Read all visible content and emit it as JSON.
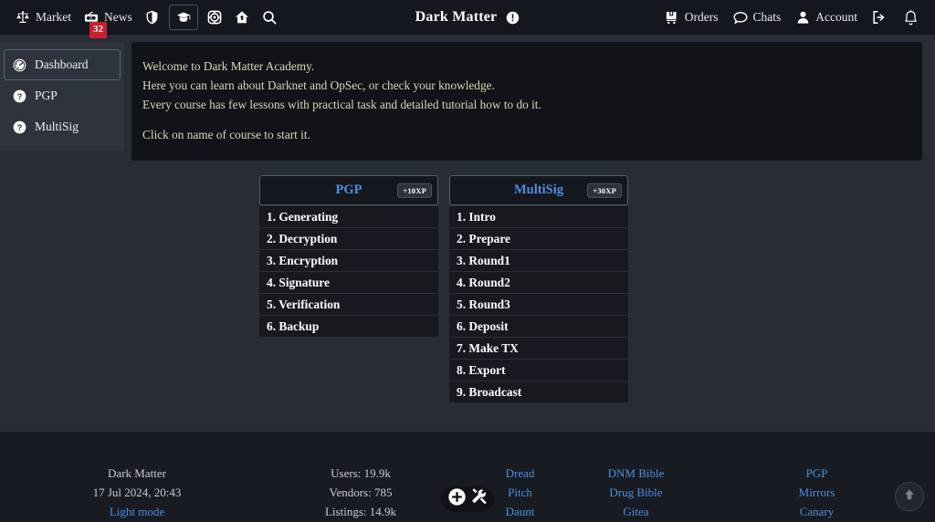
{
  "topbar": {
    "left_items": [
      {
        "label": "Market",
        "icon": "scales-icon"
      },
      {
        "label": "News",
        "icon": "radio-icon",
        "badge": "32"
      },
      {
        "label": "",
        "icon": "shield-icon"
      },
      {
        "label": "",
        "icon": "graduation-cap-icon",
        "active": true
      },
      {
        "label": "",
        "icon": "lifebuoy-icon"
      },
      {
        "label": "",
        "icon": "home-icon"
      },
      {
        "label": "",
        "icon": "search-icon"
      }
    ],
    "brand_title": "Dark Matter",
    "brand_icon": "info-circle-icon",
    "right_items": [
      {
        "label": "Orders",
        "icon": "cart-icon"
      },
      {
        "label": "Chats",
        "icon": "chat-bubble-icon"
      },
      {
        "label": "Account",
        "icon": "user-icon"
      },
      {
        "label": "",
        "icon": "logout-icon"
      },
      {
        "label": "",
        "icon": "bell-icon"
      }
    ]
  },
  "sidebar": {
    "items": [
      {
        "label": "Dashboard",
        "icon": "gauge-icon",
        "active": true
      },
      {
        "label": "PGP",
        "icon": "question-circle-icon",
        "active": false
      },
      {
        "label": "MultiSig",
        "icon": "question-circle-icon",
        "active": false
      }
    ]
  },
  "welcome": {
    "line1": "Welcome to Dark Matter Academy.",
    "line2": "Here you can learn about Darknet and OpSec, or check your knowledge.",
    "line3": "Every course has few lessons with practical task and detailed tutorial how to do it.",
    "line4": "Click on name of course to start it."
  },
  "courses": [
    {
      "title": "PGP",
      "xp": "+10XP",
      "lessons": [
        "1. Generating",
        "2. Decryption",
        "3. Encryption",
        "4. Signature",
        "5. Verification",
        "6. Backup"
      ]
    },
    {
      "title": "MultiSig",
      "xp": "+30XP",
      "lessons": [
        "1. Intro",
        "2. Prepare",
        "3. Round1",
        "4. Round2",
        "5. Round3",
        "6. Deposit",
        "7. Make TX",
        "8. Export",
        "9. Broadcast"
      ]
    }
  ],
  "footer": {
    "brand_name": "Dark Matter",
    "datetime": "17 Jul 2024, 20:43",
    "light_mode": "Light mode",
    "stats": {
      "users": "Users: 19.9k",
      "vendors": "Vendors: 785",
      "listings": "Listings: 14.9k"
    },
    "tools": [
      {
        "icon": "plus-circle-icon"
      },
      {
        "icon": "tools-icon"
      }
    ],
    "links_col1": [
      "Dread",
      "Pitch",
      "Daunt"
    ],
    "links_col2": [
      "DNM Bible",
      "Drug Bible",
      "Gitea"
    ],
    "links_col3": [
      "PGP",
      "Mirrors",
      "Canary"
    ],
    "scroll_top_icon": "arrow-up-circle-icon"
  },
  "colors": {
    "page_bg": "#272c36",
    "topbar_bg": "#14171d",
    "panel_bg": "#111319",
    "accent_link": "#4a90e2",
    "welcome_text": "#ddd4b8",
    "badge_red": "#c62033"
  }
}
